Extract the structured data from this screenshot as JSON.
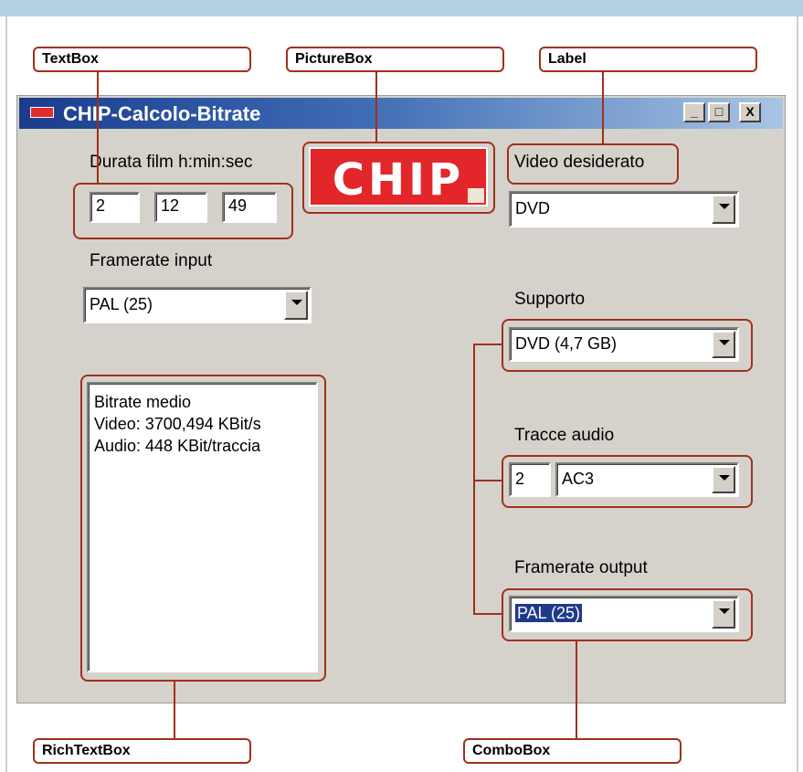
{
  "annotations": {
    "textbox": "TextBox",
    "picturebox": "PictureBox",
    "label": "Label",
    "richtextbox": "RichTextBox",
    "combobox": "ComboBox"
  },
  "window": {
    "title": "CHIP-Calcolo-Bitrate",
    "minimize": "_",
    "maximize": "□",
    "close": "X"
  },
  "duration": {
    "label": "Durata film  h:min:sec",
    "hours": "2",
    "minutes": "12",
    "seconds": "49"
  },
  "logo_text": "CHIP",
  "video": {
    "label": "Video desiderato",
    "value": "DVD"
  },
  "framerate_input": {
    "label": "Framerate input",
    "value": "PAL (25)"
  },
  "supporto": {
    "label": "Supporto",
    "value": "DVD (4,7 GB)"
  },
  "result": {
    "line1": "Bitrate medio",
    "line2": "Video: 3700,494 KBit/s",
    "line3": "Audio: 448 KBit/traccia"
  },
  "audio": {
    "label": "Tracce audio",
    "tracks": "2",
    "format": "AC3"
  },
  "framerate_output": {
    "label": "Framerate output",
    "value": "PAL (25)"
  },
  "colors": {
    "callout": "#a0301d",
    "titlebar_start": "#1a3c8e",
    "chip_red": "#e2262a",
    "selection": "#1e3a8a"
  }
}
